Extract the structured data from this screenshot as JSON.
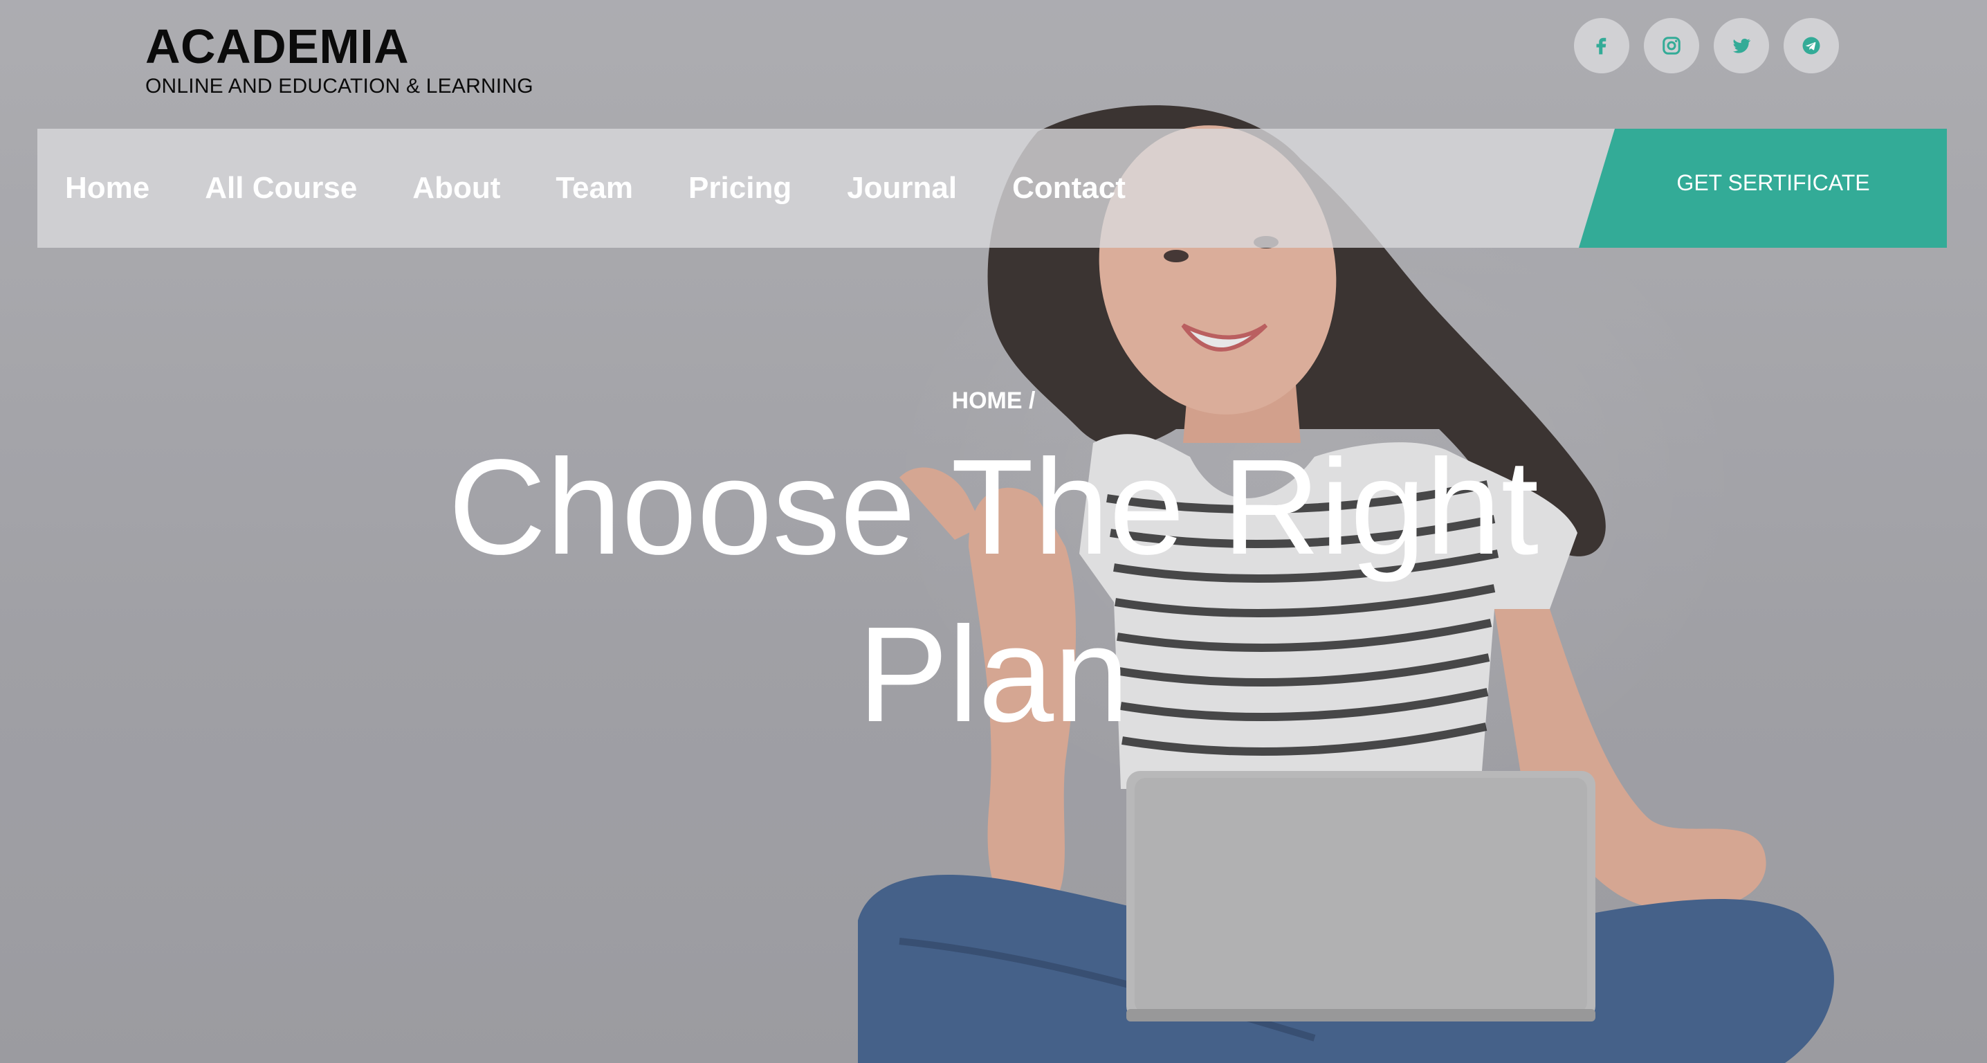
{
  "brand": {
    "title": "ACADEMIA",
    "subtitle": "ONLINE AND EDUCATION & LEARNING"
  },
  "social": [
    {
      "name": "facebook-icon"
    },
    {
      "name": "instagram-icon"
    },
    {
      "name": "twitter-icon"
    },
    {
      "name": "telegram-icon"
    }
  ],
  "nav": {
    "items": [
      "Home",
      "All Course",
      "About",
      "Team",
      "Pricing",
      "Journal",
      "Contact"
    ]
  },
  "cta": {
    "label": "GET SERTIFICATE"
  },
  "hero": {
    "breadcrumb": "HOME /",
    "headline": "Choose The Right Plan"
  },
  "colors": {
    "accent": "#33ab97",
    "background": "#a9a9ad",
    "text_light": "#ffffff",
    "text_dark": "#0b0b0b"
  }
}
